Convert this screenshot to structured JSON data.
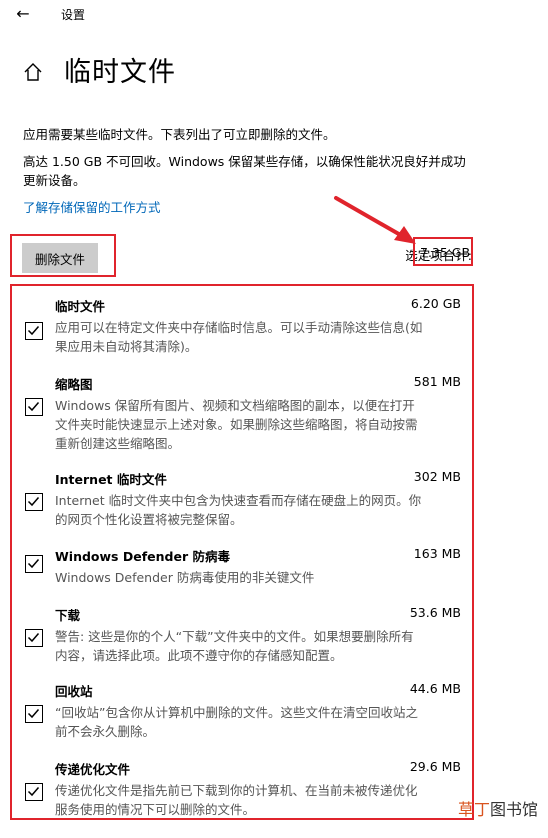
{
  "window": {
    "back_glyph": "←",
    "title": "设置"
  },
  "page": {
    "title": "临时文件",
    "description_1": "应用需要某些临时文件。下表列出了可立即删除的文件。",
    "description_2": "高达 1.50 GB 不可回收。Windows 保留某些存储，以确保性能状况良好并成功更新设备。",
    "learn_link": "了解存储保留的工作方式",
    "delete_button": "删除文件",
    "selected_total_label": "选定项合计:",
    "selected_total_value": "7.35 GB"
  },
  "items": [
    {
      "name": "临时文件",
      "size": "6.20 GB",
      "checked": true,
      "desc": "应用可以在特定文件夹中存储临时信息。可以手动清除这些信息(如果应用未自动将其清除)。"
    },
    {
      "name": "缩略图",
      "size": "581 MB",
      "checked": true,
      "desc": "Windows 保留所有图片、视频和文档缩略图的副本，以便在打开文件夹时能快速显示上述对象。如果删除这些缩略图，将自动按需重新创建这些缩略图。"
    },
    {
      "name": "Internet 临时文件",
      "size": "302 MB",
      "checked": true,
      "desc": "Internet 临时文件夹中包含为快速查看而存储在硬盘上的网页。你的网页个性化设置将被完整保留。"
    },
    {
      "name": "Windows Defender 防病毒",
      "size": "163 MB",
      "checked": true,
      "desc": "Windows Defender 防病毒使用的非关键文件"
    },
    {
      "name": "下载",
      "size": "53.6 MB",
      "checked": true,
      "desc": "警告: 这些是你的个人“下载”文件夹中的文件。如果想要删除所有内容，请选择此项。此项不遵守你的存储感知配置。"
    },
    {
      "name": "回收站",
      "size": "44.6 MB",
      "checked": true,
      "desc": "“回收站”包含你从计算机中删除的文件。这些文件在清空回收站之前不会永久删除。"
    },
    {
      "name": "传递优化文件",
      "size": "29.6 MB",
      "checked": true,
      "desc": "传递优化文件是指先前已下载到你的计算机、在当前未被传递优化服务使用的情况下可以删除的文件。"
    }
  ],
  "watermark": {
    "part1": "草丁",
    "part2": "图书馆"
  },
  "colors": {
    "highlight": "#e0242c",
    "link": "#0067b8",
    "button_bg": "#cccccc"
  }
}
